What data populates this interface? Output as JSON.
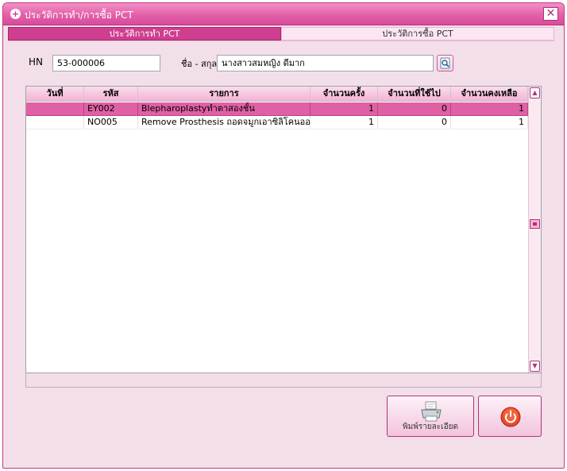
{
  "window": {
    "title": "ประวัติการทำ/การซื้อ PCT"
  },
  "tabs": [
    {
      "label": "ประวัติการทำ PCT"
    },
    {
      "label": "ประวัติการซื้อ PCT"
    }
  ],
  "form": {
    "hn_label": "HN",
    "hn_value": "53-000006",
    "name_label": "ชื่อ - สกุล",
    "name_value": "นางสาวสมหญิง ดีมาก"
  },
  "grid": {
    "columns": [
      "วันที่",
      "รหัส",
      "รายการ",
      "จำนวนครั้ง",
      "จำนวนที่ใช้ไป",
      "จำนวนคงเหลือ"
    ],
    "rows": [
      {
        "date": "",
        "code": "EY002",
        "item": "Blepharoplastyทำตาสองชั้น",
        "times": "1",
        "used": "0",
        "remaining": "1"
      },
      {
        "date": "",
        "code": "NO005",
        "item": "Remove Prosthesis ถอดจมูกเอาซิลิโคนออก",
        "times": "1",
        "used": "0",
        "remaining": "1"
      }
    ]
  },
  "buttons": {
    "print_label": "พิมพ์รายละเอียด"
  },
  "icons": {
    "title": "plus-circle-icon",
    "close": "close-icon",
    "search": "search-icon",
    "print": "printer-icon",
    "exit": "power-icon"
  },
  "colors": {
    "accent": "#d84c9b",
    "selected_row": "#e060a5",
    "header": "#f3b3d4"
  }
}
